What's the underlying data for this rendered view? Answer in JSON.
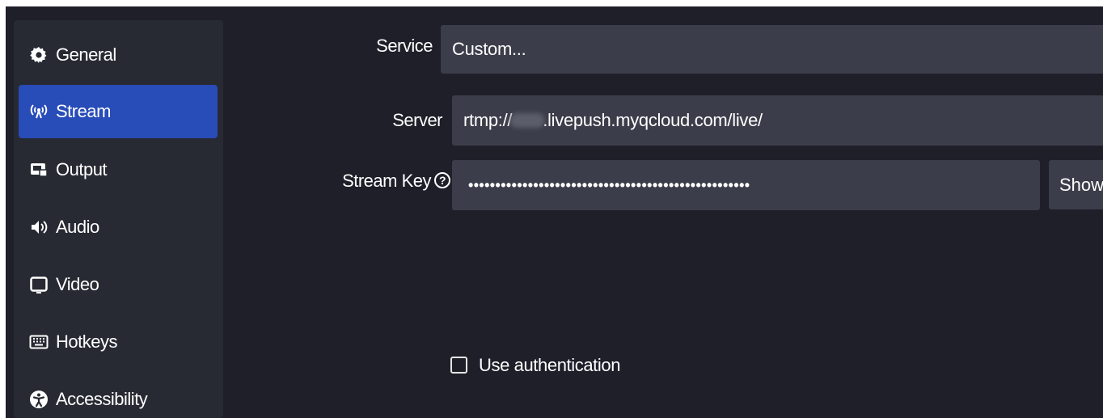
{
  "sidebar": {
    "items": [
      {
        "label": "General",
        "icon": "gear-icon"
      },
      {
        "label": "Stream",
        "icon": "antenna-icon",
        "active": true
      },
      {
        "label": "Output",
        "icon": "output-icon"
      },
      {
        "label": "Audio",
        "icon": "speaker-icon"
      },
      {
        "label": "Video",
        "icon": "monitor-icon"
      },
      {
        "label": "Hotkeys",
        "icon": "keyboard-icon"
      },
      {
        "label": "Accessibility",
        "icon": "accessibility-icon"
      }
    ]
  },
  "form": {
    "service_label": "Service",
    "service_value": "Custom...",
    "server_label": "Server",
    "server_value_prefix": "rtmp://",
    "server_value_suffix": ".livepush.myqcloud.com/live/",
    "stream_key_label": "Stream Key",
    "stream_key_value": "••••••••••••••••••••••••••••••••••••••••••••••••••••",
    "show_button_label": "Show",
    "use_auth_label": "Use authentication",
    "use_auth_checked": false
  },
  "colors": {
    "background": "#1e1f29",
    "sidebar": "#272a33",
    "active": "#284cb8",
    "field": "#3b3e4a"
  }
}
